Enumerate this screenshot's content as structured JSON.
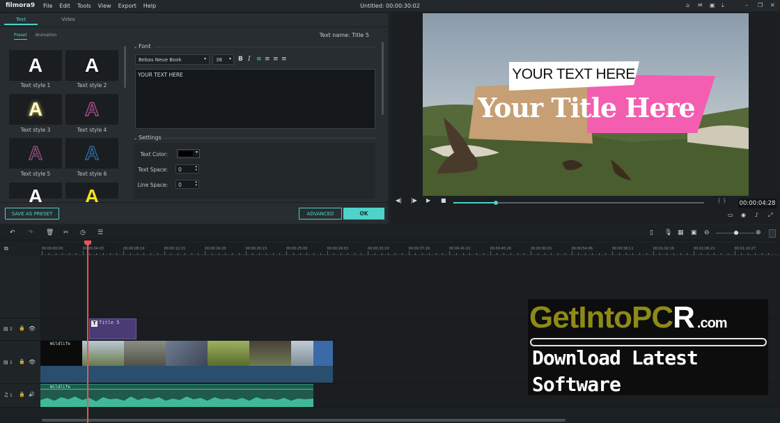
{
  "app": {
    "logo": "filmora9",
    "title": "Untitled: 00:00:30:02"
  },
  "menu": [
    "File",
    "Edit",
    "Tools",
    "View",
    "Export",
    "Help"
  ],
  "editor": {
    "tabs": [
      "Text",
      "Video"
    ],
    "subtabs": [
      "Preset",
      "Animation"
    ],
    "text_name": "Text name: Title 5",
    "styles": [
      {
        "glyph": "A",
        "label": "Text style 1"
      },
      {
        "glyph": "A",
        "label": "Text style 2"
      },
      {
        "glyph": "A",
        "label": "Text style 3"
      },
      {
        "glyph": "A",
        "label": "Text style 4"
      },
      {
        "glyph": "A",
        "label": "Text style 5"
      },
      {
        "glyph": "A",
        "label": "Text style 6"
      },
      {
        "glyph": "A",
        "label": ""
      },
      {
        "glyph": "A",
        "label": ""
      }
    ],
    "font_section": "Font",
    "font_name": "Bebas Neue Book",
    "font_size": "36",
    "text_value": "YOUR  TEXT HERE",
    "settings_section": "Settings",
    "text_color_label": "Text Color:",
    "text_space_label": "Text Space:",
    "text_space_value": "0",
    "line_space_label": "Line Space:",
    "line_space_value": "0",
    "save_preset": "SAVE AS PRESET",
    "advanced": "ADVANCED",
    "ok": "OK"
  },
  "preview": {
    "banner_text": "YOUR  TEXT HERE",
    "title_text": "Your Title Here",
    "timecode": "00:00:04:28",
    "progress": 0.17
  },
  "timeline": {
    "ticks": [
      "00:00:00:00",
      "00:00:04:03",
      "00:00:08:10",
      "00:00:12:15",
      "00:00:16:20",
      "00:00:20:23",
      "00:00:25:00",
      "00:00:29:03",
      "00:00:33:10",
      "00:00:37:16",
      "00:00:41:21",
      "00:00:45:26",
      "00:00:50:01",
      "00:00:54:06",
      "00:00:58:11",
      "00:01:02:16",
      "00:01:06:21",
      "00:01:10:27"
    ],
    "title_clip": "Title 5",
    "video_clip": "Wildlife",
    "audio_clip": "Wildlife",
    "track_labels": [
      "2",
      "1",
      "1"
    ]
  },
  "watermark": {
    "line1a": "GetIntoPC",
    "line1b": "R",
    "line1c": ".com",
    "line2": "Download Latest",
    "line3": "Software"
  }
}
